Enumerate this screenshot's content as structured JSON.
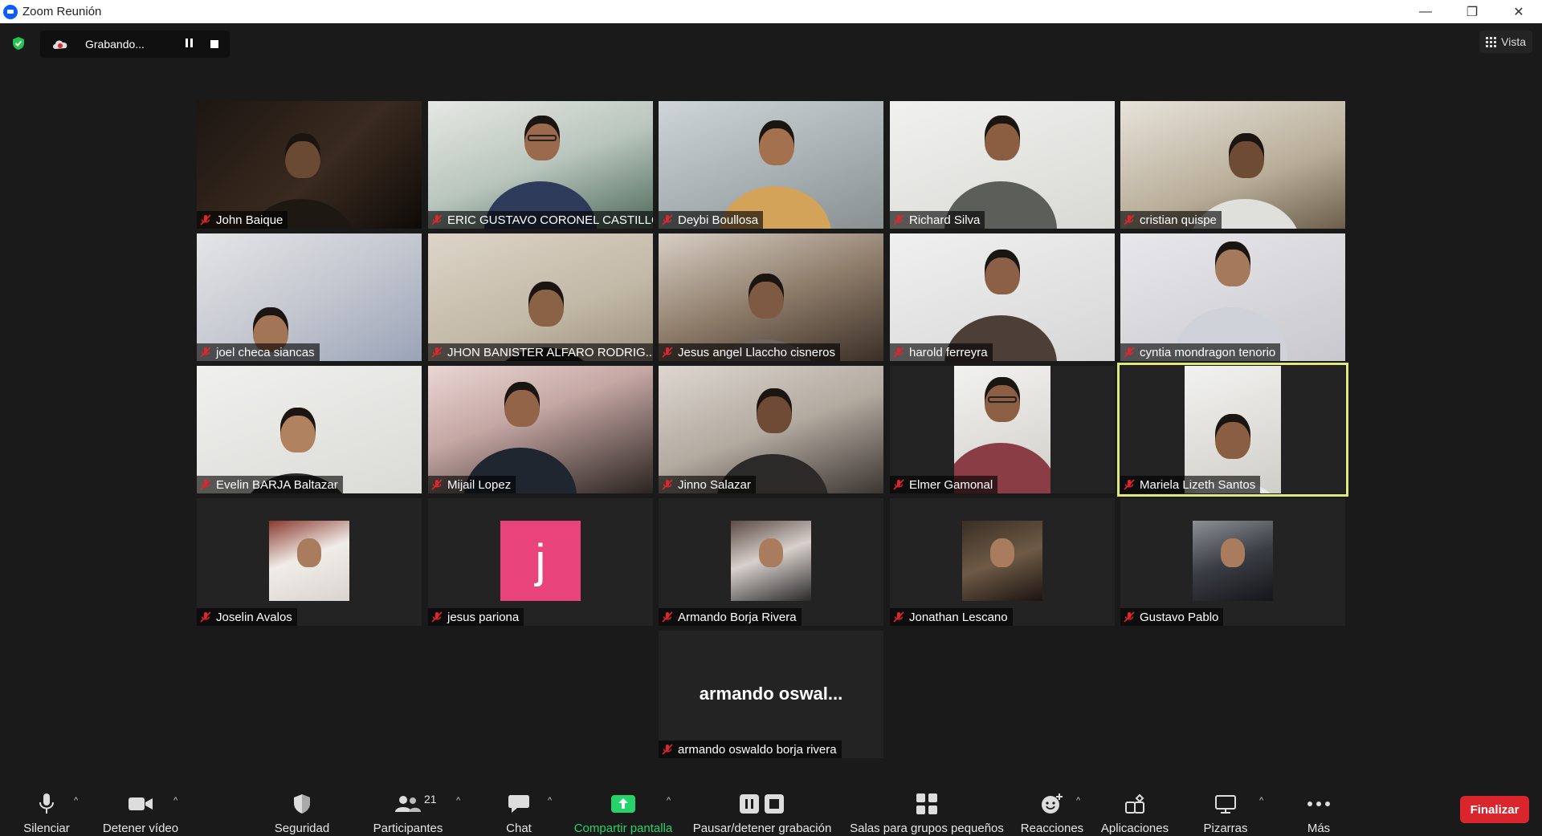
{
  "window": {
    "title": "Zoom Reunión",
    "minimize": "—",
    "restore": "❐",
    "close": "✕"
  },
  "recording": {
    "status": "Grabando..."
  },
  "view": {
    "label": "Vista"
  },
  "participants": [
    {
      "name": "John Baique"
    },
    {
      "name": "ERIC GUSTAVO CORONEL CASTILLO"
    },
    {
      "name": "Deybi Boullosa"
    },
    {
      "name": "Richard Silva"
    },
    {
      "name": "cristian quispe"
    },
    {
      "name": "joel checa siancas"
    },
    {
      "name": "JHON BANISTER ALFARO RODRIG..."
    },
    {
      "name": "Jesus angel Llaccho cisneros"
    },
    {
      "name": "harold ferreyra"
    },
    {
      "name": "cyntia mondragon tenorio"
    },
    {
      "name": "Evelin BARJA  Baltazar"
    },
    {
      "name": "Mijail Lopez"
    },
    {
      "name": "Jinno Salazar"
    },
    {
      "name": "Elmer Gamonal"
    },
    {
      "name": "Mariela Lizeth Santos"
    },
    {
      "name": "Joselin Avalos"
    },
    {
      "name": "jesus pariona",
      "avatar_letter": "j"
    },
    {
      "name": "Armando Borja Rivera"
    },
    {
      "name": "Jonathan Lescano"
    },
    {
      "name": "Gustavo Pablo"
    },
    {
      "name": "armando oswaldo borja rivera",
      "display_name": "armando  oswal..."
    }
  ],
  "toolbar": {
    "mute": "Silenciar",
    "stop_video": "Detener vídeo",
    "security": "Seguridad",
    "participants": "Participantes",
    "participants_count": "21",
    "chat": "Chat",
    "share_screen": "Compartir pantalla",
    "pause_recording": "Pausar/detener grabación",
    "breakout_rooms": "Salas para grupos pequeños",
    "reactions": "Reacciones",
    "apps": "Aplicaciones",
    "whiteboards": "Pizarras",
    "more": "Más",
    "end": "Finalizar"
  },
  "colors": {
    "accent_green": "#26d26a",
    "end_red": "#d9262c",
    "active_speaker": "#dfe87a",
    "avatar_pink": "#e8437b"
  }
}
